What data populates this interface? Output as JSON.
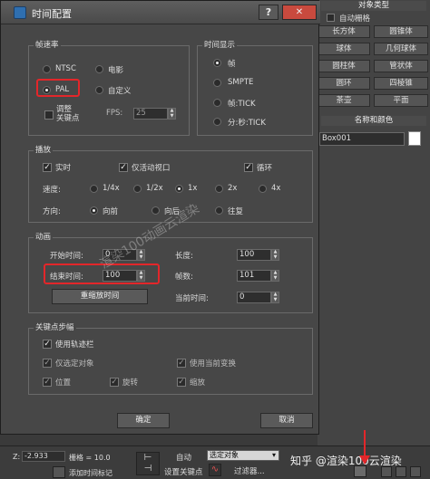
{
  "dialog": {
    "title": "时间配置",
    "help_label": "?",
    "close_label": "✕",
    "frame_rate": {
      "group_label": "帧速率",
      "options": [
        "NTSC",
        "电影",
        "PAL",
        "自定义"
      ],
      "selected": "PAL",
      "adjust_keys_label": "调整\n关键点",
      "fps_label": "FPS:",
      "fps_value": "25"
    },
    "time_display": {
      "group_label": "时间显示",
      "options": [
        "帧",
        "SMPTE",
        "帧:TICK",
        "分:秒:TICK"
      ],
      "selected": "帧"
    },
    "playback": {
      "group_label": "播放",
      "realtime_label": "实时",
      "realtime_checked": true,
      "active_viewport_label": "仅活动视口",
      "active_viewport_checked": true,
      "loop_label": "循环",
      "loop_checked": true,
      "speed_label": "速度:",
      "speeds": [
        "1/4x",
        "1/2x",
        "1x",
        "2x",
        "4x"
      ],
      "speed_selected": "1x",
      "direction_label": "方向:",
      "directions": [
        "向前",
        "向后",
        "往复"
      ],
      "direction_selected": "向前"
    },
    "animation": {
      "group_label": "动画",
      "start_time_label": "开始时间:",
      "start_time_value": "0",
      "end_time_label": "结束时间:",
      "end_time_value": "100",
      "length_label": "长度:",
      "length_value": "100",
      "frame_count_label": "帧数:",
      "frame_count_value": "101",
      "rescale_label": "重缩放时间",
      "current_time_label": "当前时间:",
      "current_time_value": "0"
    },
    "key_steps": {
      "group_label": "关键点步幅",
      "use_trackbar_label": "使用轨迹栏",
      "use_trackbar_checked": true,
      "selected_only_label": "仅选定对象",
      "selected_only_checked": true,
      "use_current_transform_label": "使用当前变换",
      "use_current_transform_checked": true,
      "position_label": "位置",
      "position_checked": true,
      "rotation_label": "旋转",
      "rotation_checked": true,
      "scale_label": "缩放",
      "scale_checked": true
    },
    "ok_label": "确定",
    "cancel_label": "取消"
  },
  "watermark": "渲染100动画云渲染",
  "right_panel": {
    "object_type_header": "对象类型",
    "autogrid_label": "自动栅格",
    "objects": [
      "长方体",
      "圆锥体",
      "球体",
      "几何球体",
      "圆柱体",
      "管状体",
      "圆环",
      "四棱锥",
      "茶壶",
      "平面"
    ],
    "name_color_header": "名称和颜色",
    "object_name": "Box001",
    "object_color": "#ffffff"
  },
  "bottom_bar": {
    "z_label": "Z:",
    "z_value": "-2.933",
    "grid_label": "栅格 = 10.0",
    "add_time_tag": "添加时间标记",
    "auto_key_label": "自动",
    "set_key_label": "设置关键点",
    "selected_label": "选定对象",
    "filter_label": "过滤器...",
    "zhihu_watermark": "知乎 @渲染100云渲染"
  },
  "accent_red": "#e3262a"
}
